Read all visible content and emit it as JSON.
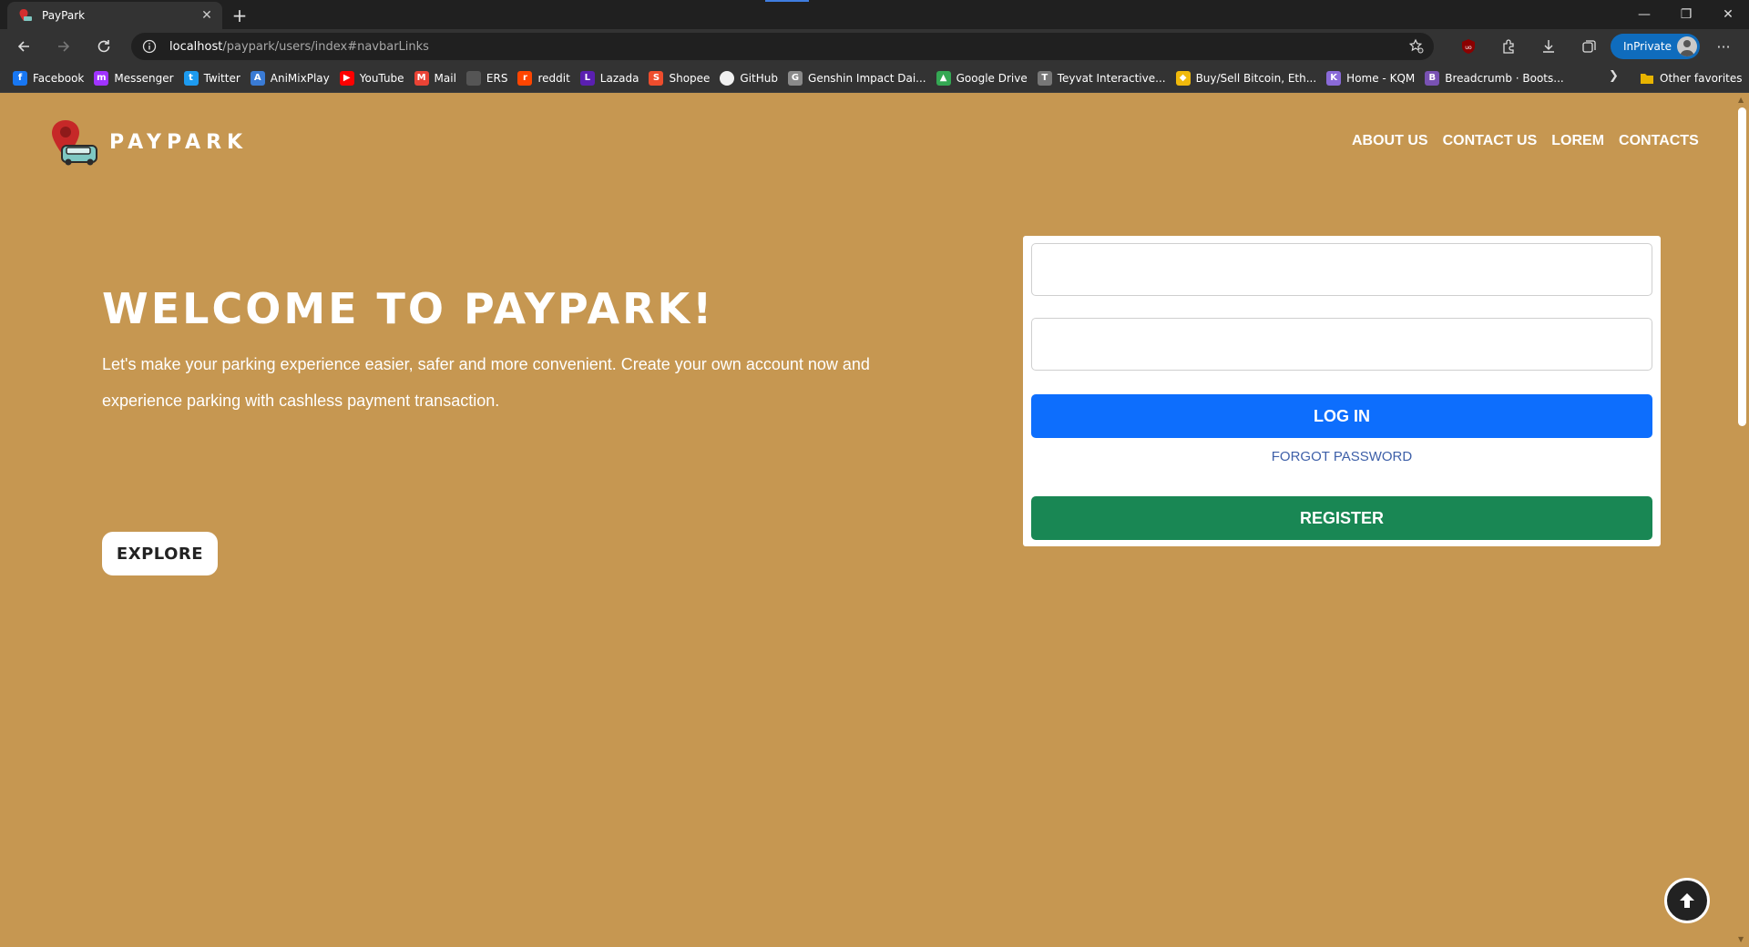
{
  "browser": {
    "tab": {
      "title": "PayPark"
    },
    "address": {
      "host": "localhost",
      "path": "/paypark/users/index#navbarLinks"
    },
    "inprivate_label": "InPrivate",
    "bookmarks": [
      {
        "label": "Facebook",
        "color": "#1877f2",
        "glyph": "f"
      },
      {
        "label": "Messenger",
        "color": "#a033ff",
        "glyph": "m"
      },
      {
        "label": "Twitter",
        "color": "#1d9bf0",
        "glyph": "t"
      },
      {
        "label": "AniMixPlay",
        "color": "#3a7bd5",
        "glyph": "A"
      },
      {
        "label": "YouTube",
        "color": "#ff0000",
        "glyph": "▶"
      },
      {
        "label": "Mail",
        "color": "#ea4335",
        "glyph": "M"
      },
      {
        "label": "ERS",
        "color": "#555555",
        "glyph": ""
      },
      {
        "label": "reddit",
        "color": "#ff4500",
        "glyph": "r"
      },
      {
        "label": "Lazada",
        "color": "#5a1fb0",
        "glyph": "L"
      },
      {
        "label": "Shopee",
        "color": "#ee4d2d",
        "glyph": "S"
      },
      {
        "label": "GitHub",
        "color": "#f0f0f0",
        "glyph": ""
      },
      {
        "label": "Genshin Impact Dai...",
        "color": "#8a8a8a",
        "glyph": "G"
      },
      {
        "label": "Google Drive",
        "color": "#34a853",
        "glyph": "▲"
      },
      {
        "label": "Teyvat Interactive...",
        "color": "#777777",
        "glyph": "T"
      },
      {
        "label": "Buy/Sell Bitcoin, Eth...",
        "color": "#f0b90b",
        "glyph": "◆"
      },
      {
        "label": "Home - KQM",
        "color": "#8a6ad8",
        "glyph": "K"
      },
      {
        "label": "Breadcrumb · Boots...",
        "color": "#7952b3",
        "glyph": "B"
      }
    ],
    "other_favorites": "Other favorites"
  },
  "site": {
    "brand": "PAYPARK",
    "nav": [
      "ABOUT US",
      "CONTACT US",
      "LOREM",
      "CONTACTS"
    ],
    "hero": {
      "title": "WELCOME TO PAYPARK!",
      "text": "Let's make your parking experience easier, safer and more convenient. Create your own account now and experience parking with cashless payment transaction.",
      "explore_label": "EXPLORE"
    },
    "login": {
      "username_value": "",
      "password_value": "",
      "login_label": "LOG IN",
      "forgot_label": "FORGOT PASSWORD",
      "register_label": "REGISTER"
    }
  },
  "colors": {
    "page_bg": "#c69751",
    "login_button": "#0d6efd",
    "register_button": "#198754",
    "link": "#3d5fa8"
  },
  "icons": [
    "back-icon",
    "forward-icon",
    "refresh-icon",
    "info-icon",
    "favorite-star-icon",
    "ublock-icon",
    "extensions-icon",
    "download-icon",
    "collections-icon",
    "more-icon",
    "arrow-up-icon"
  ]
}
